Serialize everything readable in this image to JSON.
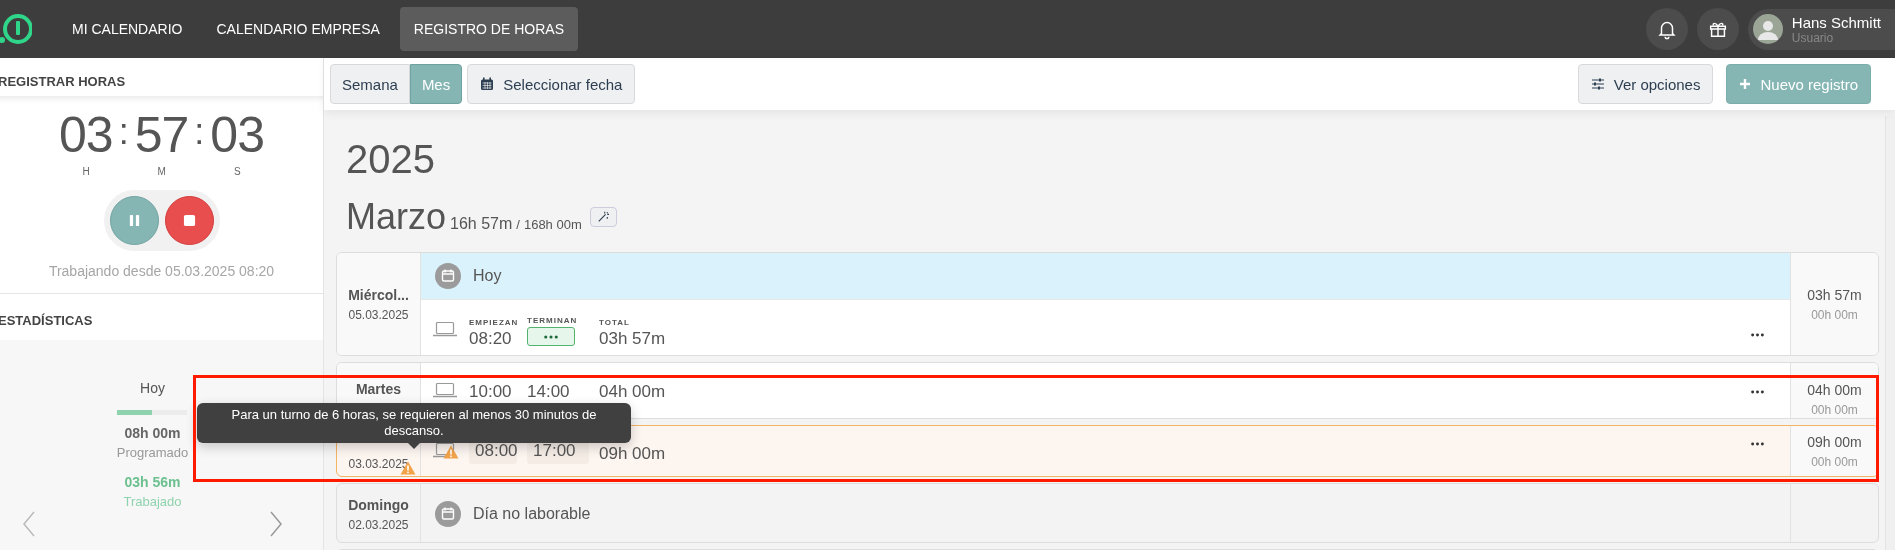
{
  "nav": {
    "items": [
      {
        "label": "MI CALENDARIO",
        "selected": false
      },
      {
        "label": "CALENDARIO EMPRESA",
        "selected": false
      },
      {
        "label": "REGISTRO DE HORAS",
        "selected": true
      }
    ]
  },
  "user": {
    "name": "Hans Schmitt",
    "role": "Usuario"
  },
  "timer_panel": {
    "title": "REGISTRAR HORAS",
    "hours": "03",
    "minutes": "57",
    "seconds": "03",
    "separator": ":",
    "unit_labels": [
      "H",
      "M",
      "S"
    ],
    "status": "Trabajando desde 05.03.2025 08:20"
  },
  "stats": {
    "title": "ESTADÍSTICAS",
    "period": "Hoy",
    "level": 0.49,
    "scheduled": "08h 00m",
    "scheduled_label": "Programado",
    "worked": "03h 56m",
    "worked_label": "Trabajado"
  },
  "toolbar": {
    "view_tabs": [
      {
        "label": "Semana",
        "selected": false
      },
      {
        "label": "Mes",
        "selected": true
      }
    ],
    "date_button": "Seleccionar fecha",
    "options_button": "Ver opciones",
    "new_button": "Nuevo registro"
  },
  "year": "2025",
  "month": {
    "name": "Marzo",
    "worked": "16h 57m",
    "separator": "/",
    "target": "168h 00m"
  },
  "days": [
    {
      "kind": "today",
      "day_name": "Miércol...",
      "date": "05.03.2025",
      "date_warning": false,
      "banner": "Hoy",
      "entries": [
        {
          "kind": "running",
          "start_label": "EMPIEZAN",
          "end_label": "TERMINAN",
          "total_label": "TOTAL",
          "start": "08:20",
          "total": "03h 57m",
          "warning": false
        }
      ],
      "total": "03h 57m",
      "break": "00h 00m"
    },
    {
      "kind": "work",
      "day_name": "Martes",
      "date_warning": false,
      "entries": [
        {
          "kind": "closed",
          "start": "10:00",
          "end": "14:00",
          "total": "04h 00m",
          "warning": false
        }
      ],
      "total": "04h 00m",
      "break": "00h 00m"
    },
    {
      "kind": "warning",
      "date": "03.03.2025",
      "date_warning": true,
      "entries": [
        {
          "kind": "closed",
          "start": "08:00",
          "end": "17:00",
          "total": "09h 00m",
          "warning": true
        }
      ],
      "total": "09h 00m",
      "break": "00h 00m"
    },
    {
      "kind": "off",
      "day_name": "Domingo",
      "date": "02.03.2025",
      "date_warning": false,
      "banner": "Día no laborable"
    },
    {
      "kind": "off"
    }
  ],
  "tooltip": {
    "text": "Para un turno de 6 horas, se requieren al menos 30 minutos de descanso."
  }
}
